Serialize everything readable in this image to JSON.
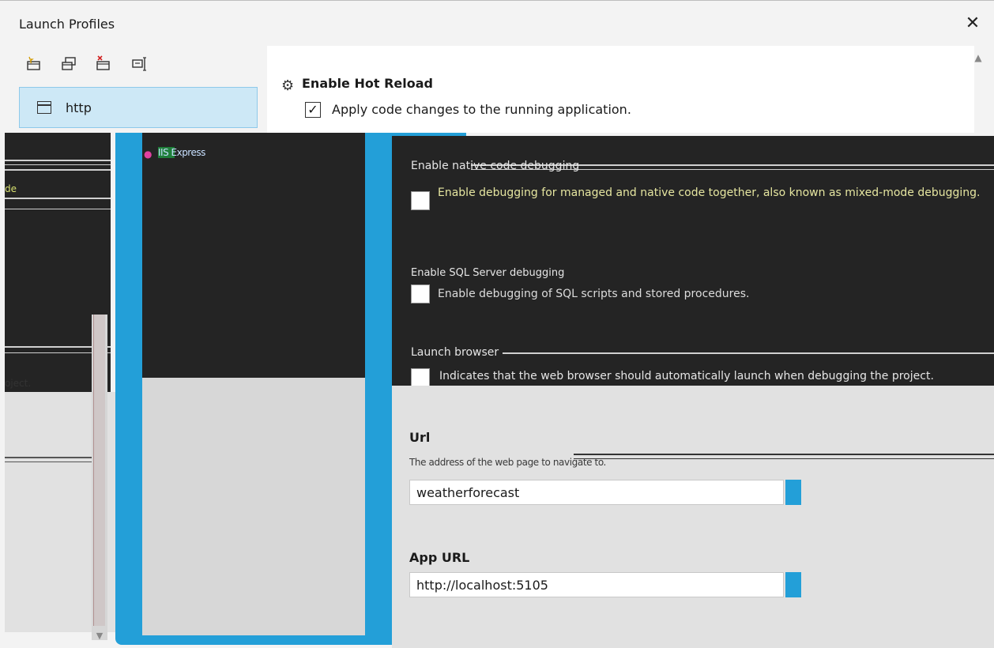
{
  "window": {
    "title": "Launch Profiles",
    "close_glyph": "✕"
  },
  "toolbar": {
    "icons": [
      "new-profile-icon",
      "copy-profile-icon",
      "delete-profile-icon",
      "rename-profile-icon"
    ]
  },
  "profiles": [
    {
      "label": "http",
      "selected": true
    },
    {
      "label": "IIS Express",
      "selected": false
    }
  ],
  "hot_reload": {
    "title": "Enable Hot Reload",
    "checkbox_label": "Apply code changes to the running application.",
    "checked": true
  },
  "native_debug": {
    "title": "Enable native code debugging",
    "desc": "Enable debugging for managed and native code together, also known as mixed-mode debugging.",
    "checked": false
  },
  "sql_debug": {
    "title": "Enable SQL Server debugging",
    "desc": "Enable debugging of SQL scripts and stored procedures.",
    "checked": false
  },
  "launch_browser": {
    "title": "Launch browser",
    "desc": "Indicates that the web browser should automatically launch when debugging the project.",
    "checked": false
  },
  "url": {
    "title": "Url",
    "hint": "The address of the web page to navigate to.",
    "value": "weatherforecast"
  },
  "app_url": {
    "title": "App URL",
    "value": "http://localhost:5105"
  },
  "left_fragments": {
    "frag1": "de",
    "frag2": "oject."
  },
  "colors": {
    "accent": "#239fd8",
    "selection": "#cde8f6",
    "dark": "#242424"
  }
}
